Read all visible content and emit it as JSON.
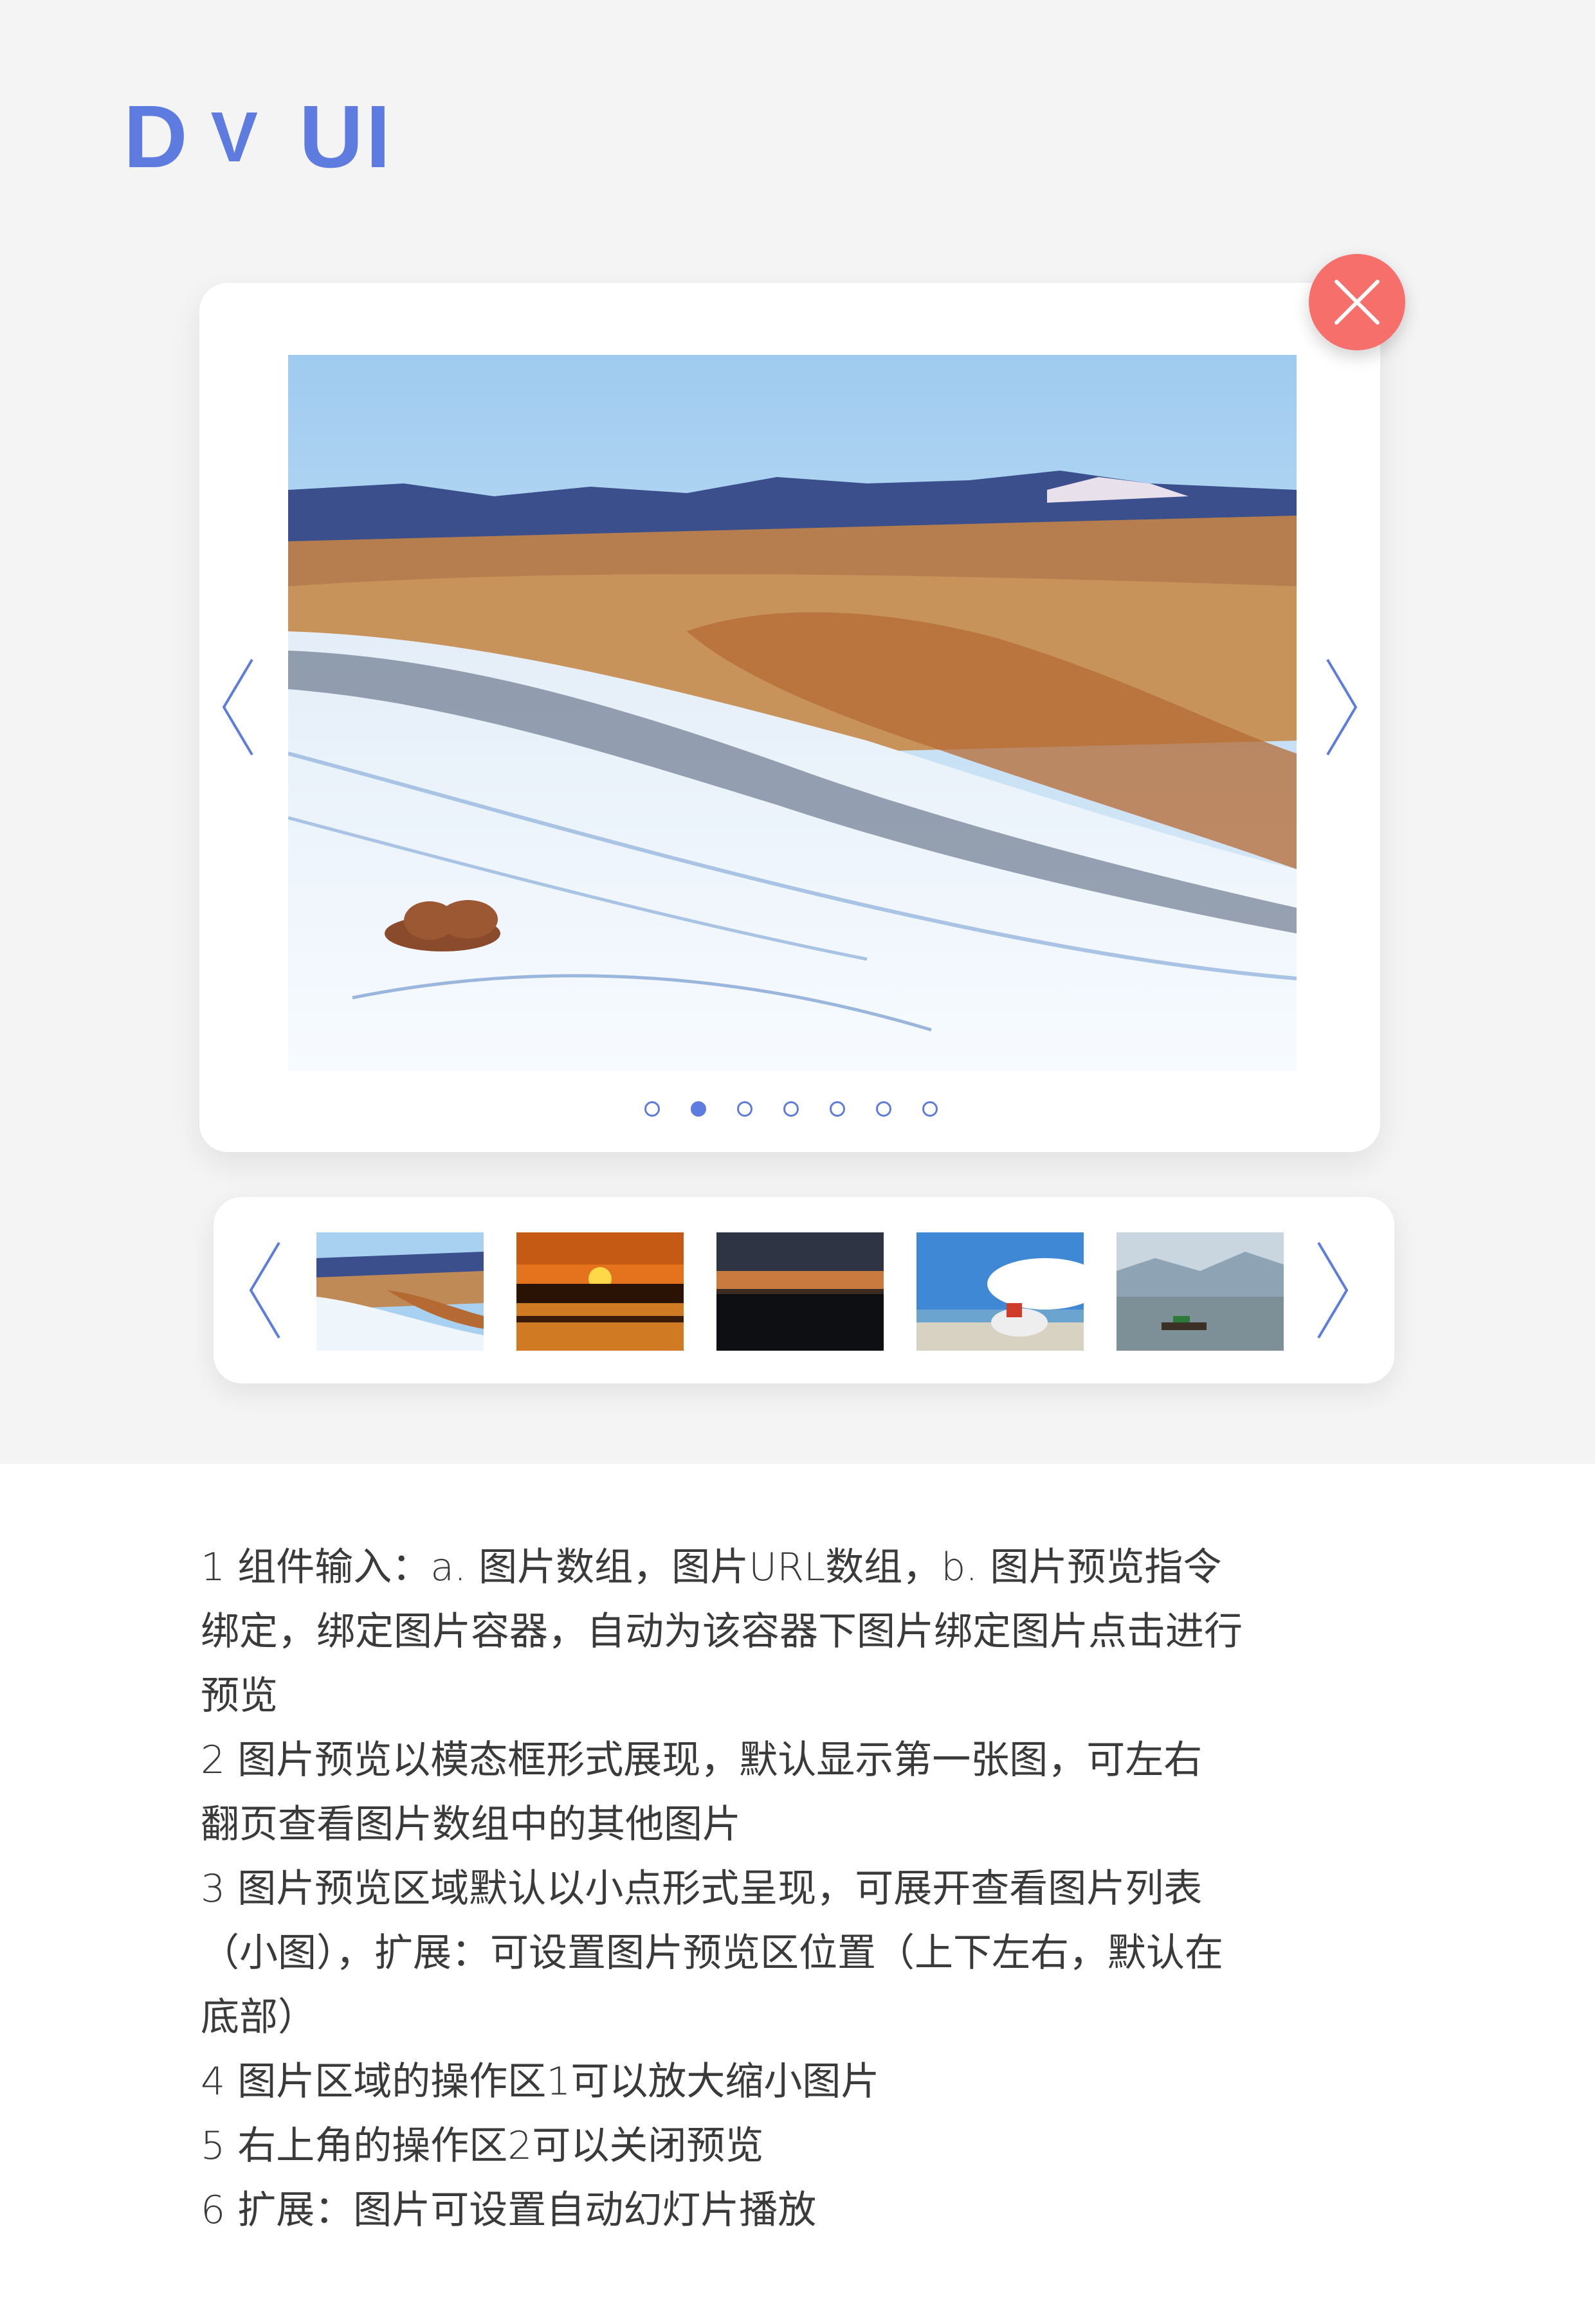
{
  "logo": {
    "letters": [
      "D",
      "V",
      "UI"
    ]
  },
  "colors": {
    "accent": "#5e7ce0",
    "close": "#f66f6a",
    "background": "#f4f4f5"
  },
  "preview": {
    "close_icon": "close-icon",
    "prev_icon": "chevron-left-icon",
    "next_icon": "chevron-right-icon",
    "dots_total": 7,
    "active_dot": 2
  },
  "thumbnails": [
    {
      "name": "thumbnail-snow"
    },
    {
      "name": "thumbnail-sunset"
    },
    {
      "name": "thumbnail-dusk"
    },
    {
      "name": "thumbnail-yak"
    },
    {
      "name": "thumbnail-lake"
    }
  ],
  "description": [
    "1  组件输入：a. 图片数组，图片URL数组，b. 图片预览指令",
    "绑定，绑定图片容器，自动为该容器下图片绑定图片点击进行",
    "预览",
    "2  图片预览以模态框形式展现，默认显示第一张图，可左右",
    "翻页查看图片数组中的其他图片",
    "3  图片预览区域默认以小点形式呈现，可展开查看图片列表",
    "（小图），扩展：可设置图片预览区位置（上下左右，默认在",
    "底部）",
    "4  图片区域的操作区1可以放大缩小图片",
    "5  右上角的操作区2可以关闭预览",
    "6  扩展：图片可设置自动幻灯片播放"
  ]
}
